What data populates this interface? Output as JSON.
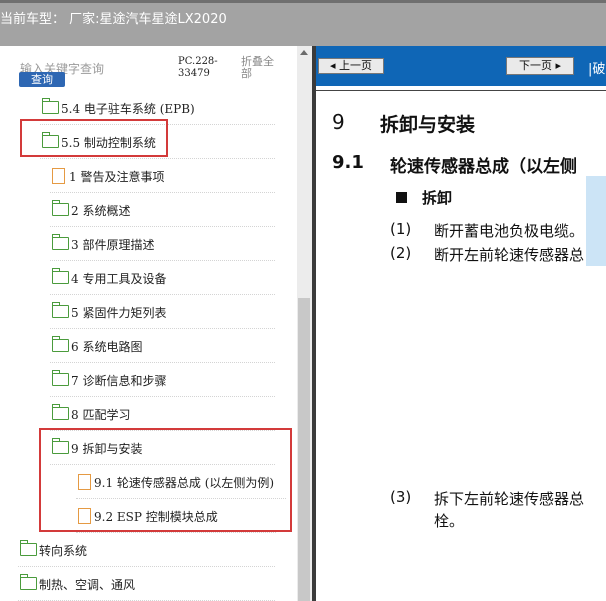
{
  "header": {
    "vehicle_label": "当前车型：  厂家:星途汽车星途LX2020"
  },
  "left_panel": {
    "search_placeholder": "输入关键字查询",
    "search_button": "查询",
    "code": [
      "PC.228-",
      "33479"
    ],
    "fold": [
      "折叠全",
      "部"
    ],
    "tree": [
      {
        "label": "5.4 电子驻车系统 (EPB)",
        "icon": "folder-open-icon"
      },
      {
        "label": "5.5 制动控制系统",
        "icon": "folder-open-icon"
      },
      {
        "label": "1 警告及注意事项",
        "icon": "file-icon"
      },
      {
        "label": "2 系统概述",
        "icon": "folder-open-icon"
      },
      {
        "label": "3 部件原理描述",
        "icon": "folder-open-icon"
      },
      {
        "label": "4 专用工具及设备",
        "icon": "folder-open-icon"
      },
      {
        "label": "5 紧固件力矩列表",
        "icon": "folder-open-icon"
      },
      {
        "label": "6 系统电路图",
        "icon": "folder-open-icon"
      },
      {
        "label": "7 诊断信息和步骤",
        "icon": "folder-open-icon"
      },
      {
        "label": "8 匹配学习",
        "icon": "folder-open-icon"
      },
      {
        "label": "9 拆卸与安装",
        "icon": "folder-open-icon"
      },
      {
        "label": "9.1 轮速传感器总成 (以左侧为例)",
        "icon": "file-icon"
      },
      {
        "label": "9.2 ESP 控制模块总成",
        "icon": "file-icon"
      },
      {
        "label": "转向系统",
        "icon": "folder-open-icon"
      },
      {
        "label": "制热、空调、通风",
        "icon": "folder-open-icon"
      }
    ]
  },
  "doc": {
    "prev_button": "上一页",
    "next_button": "下一页",
    "truncated_right": "|破",
    "section_num": "9",
    "section_title": "拆卸与安装",
    "subsection_num": "9.1",
    "subsection_title": "轮速传感器总成（以左侧",
    "step_heading": "拆卸",
    "steps": [
      {
        "num": "(1)",
        "text": "断开蓄电池负极电缆。"
      },
      {
        "num": "(2)",
        "text": "断开左前轮速传感器总"
      },
      {
        "num": "(3)",
        "text": "拆下左前轮速传感器总"
      }
    ],
    "step3_continued": "栓。"
  },
  "colors": {
    "toolbar": "#0f66b6",
    "highlight": "#d33a3a",
    "folder": "#4a9b3c",
    "file": "#e59a43"
  }
}
